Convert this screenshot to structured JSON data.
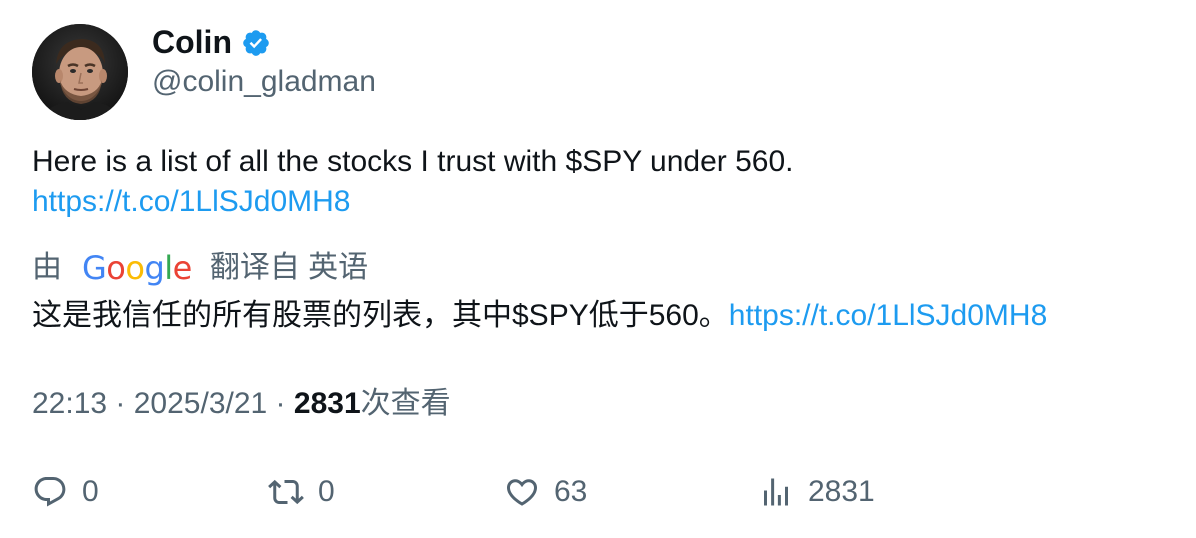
{
  "author": {
    "display_name": "Colin",
    "handle": "@colin_gladman",
    "verified_icon": "verified-badge-icon",
    "avatar_icon": "avatar"
  },
  "tweet": {
    "text": "Here is a list of all the stocks I trust with $SPY under 560.",
    "link": "https://t.co/1LlSJd0MH8"
  },
  "translation": {
    "prefix": "由",
    "provider": "Google",
    "suffix": "翻译自 英语",
    "text": "这是我信任的所有股票的列表，其中$SPY低于560。",
    "link": "https://t.co/1LlSJd0MH8"
  },
  "meta": {
    "time": "22:13",
    "separator": " · ",
    "date": "2025/3/21",
    "views_count": "2831",
    "views_label": "次查看"
  },
  "actions": {
    "reply": {
      "icon": "reply-icon",
      "count": "0"
    },
    "retweet": {
      "icon": "retweet-icon",
      "count": "0"
    },
    "like": {
      "icon": "heart-icon",
      "count": "63"
    },
    "views": {
      "icon": "analytics-icon",
      "count": "2831"
    }
  },
  "colors": {
    "text": "#0f1419",
    "secondary": "#536471",
    "link": "#1d9bf0",
    "verified": "#1d9bf0"
  }
}
